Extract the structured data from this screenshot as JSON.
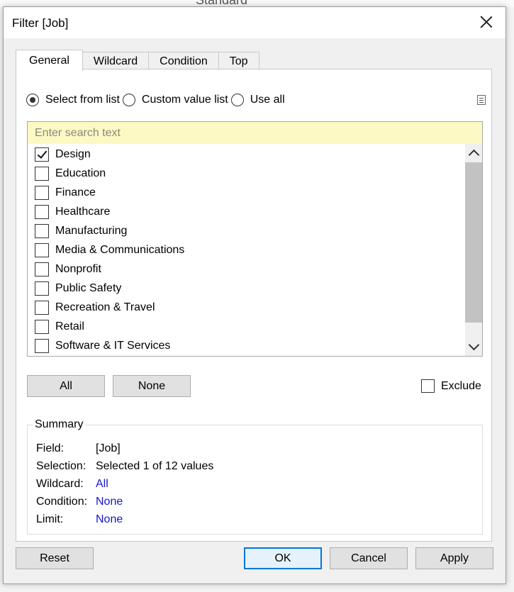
{
  "background": {
    "top_text": "Standard"
  },
  "dialog": {
    "title": "Filter [Job]"
  },
  "tabs": [
    {
      "label": "General",
      "active": true
    },
    {
      "label": "Wildcard",
      "active": false
    },
    {
      "label": "Condition",
      "active": false
    },
    {
      "label": "Top",
      "active": false
    }
  ],
  "radios": [
    {
      "label": "Select from list",
      "checked": true
    },
    {
      "label": "Custom value list",
      "checked": false
    },
    {
      "label": "Use all",
      "checked": false
    }
  ],
  "search": {
    "placeholder": "Enter search text",
    "value": ""
  },
  "list_items": [
    {
      "label": "Design",
      "checked": true
    },
    {
      "label": "Education",
      "checked": false
    },
    {
      "label": "Finance",
      "checked": false
    },
    {
      "label": "Healthcare",
      "checked": false
    },
    {
      "label": "Manufacturing",
      "checked": false
    },
    {
      "label": "Media & Communications",
      "checked": false
    },
    {
      "label": "Nonprofit",
      "checked": false
    },
    {
      "label": "Public Safety",
      "checked": false
    },
    {
      "label": "Recreation & Travel",
      "checked": false
    },
    {
      "label": "Retail",
      "checked": false
    },
    {
      "label": "Software & IT Services",
      "checked": false
    }
  ],
  "list_buttons": {
    "all_label": "All",
    "none_label": "None"
  },
  "exclude": {
    "label": "Exclude",
    "checked": false
  },
  "summary": {
    "title": "Summary",
    "rows": [
      {
        "label": "Field:",
        "value": "[Job]",
        "link": false
      },
      {
        "label": "Selection:",
        "value": "Selected 1 of 12 values",
        "link": false
      },
      {
        "label": "Wildcard:",
        "value": "All",
        "link": true
      },
      {
        "label": "Condition:",
        "value": "None",
        "link": true
      },
      {
        "label": "Limit:",
        "value": "None",
        "link": true
      }
    ]
  },
  "footer": {
    "reset_label": "Reset",
    "ok_label": "OK",
    "cancel_label": "Cancel",
    "apply_label": "Apply"
  },
  "colors": {
    "link": "#1515d6",
    "search_bg": "#fdf9c4",
    "primary_border": "#0078d7"
  }
}
